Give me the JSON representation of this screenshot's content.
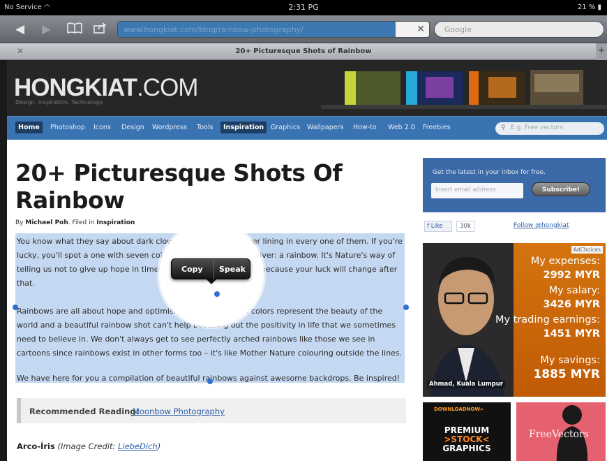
{
  "status_bar": {
    "carrier": "No Service",
    "time": "2:31 PG",
    "battery": "21 %"
  },
  "toolbar": {
    "url": "www.hongkiat.com/blog/rainbow-photography/",
    "search_placeholder": "Google"
  },
  "tab": {
    "title": "20+ Picturesque Shots of Rainbow"
  },
  "site": {
    "logo_main": "HONGKIAT",
    "logo_suffix": ".COM",
    "tagline": "Design. Inspiration. Technology.",
    "nav": [
      "Home",
      "Photoshop",
      "Icons",
      "Design",
      "Wordpress",
      "Tools",
      "Inspiration",
      "Graphics",
      "Wallpapers",
      "How-to",
      "Web 2.0",
      "Freebies"
    ],
    "nav_active": "Inspiration",
    "nav_search_placeholder": "E.g. Free vectors"
  },
  "article": {
    "title": "20+ Picturesque Shots Of Rainbow",
    "byline_prefix": "By",
    "author": "Michael Poh",
    "filed_in": "Filed in",
    "category": "Inspiration",
    "paragraphs": [
      "You know what they say about dark clouds, that there's a silver lining in every one of them. If you're lucky, you'll spot a one with seven colours instead of just the silver: a rainbow. It's Nature's way of telling us not to give up hope in times of adversity and despair because your luck will change after that.",
      "Rainbows are all about hope and optimism. The spectrum of colors represent the beauty of the world and a beautiful rainbow shot can't help but bring out the positivity in life that we sometimes need to believe in. We don't always get to see perfectly arched rainbows like those we see in cartoons since rainbows exist in other forms too – it's like Mother Nature colouring outside the lines.",
      "We have here for you a compilation of beautiful rainbows against awesome backdrops. Be inspired!"
    ],
    "recommended_label": "Recommended Reading:",
    "recommended_link": "Moonbow Photography",
    "first_item_title": "Arco-Íris",
    "first_item_credit_prefix": "(Image Credit:",
    "first_item_credit_link": "LiebeDich",
    "first_item_credit_suffix": ")"
  },
  "popup": {
    "copy": "Copy",
    "speak": "Speak"
  },
  "sidebar": {
    "newsletter_text": "Get the latest in your inbox for free.",
    "email_placeholder": "Insert email address",
    "subscribe": "Subscribe!",
    "like": "Like",
    "like_count": "30k",
    "follow": "Follow @hongkiat",
    "ad_choices": "AdChoices",
    "ad_lines": [
      "My expenses:",
      "2992 MYR",
      "My salary:",
      "3426 MYR",
      "My trading earnings:",
      "1451 MYR",
      "My savings:",
      "1885 MYR"
    ],
    "ad_person": "Ahmad, Kuala Lumpur",
    "ad2_download": "DOWNLOADNOW»",
    "ad2_title": [
      "PREMIUM",
      ">STOCK<",
      "GRAPHICS"
    ],
    "ad3_title": "FreeVectors"
  },
  "colors": {
    "nav_bg": "#3a73b2",
    "selection": "#548dd6",
    "accent_orange": "#d4740e"
  }
}
